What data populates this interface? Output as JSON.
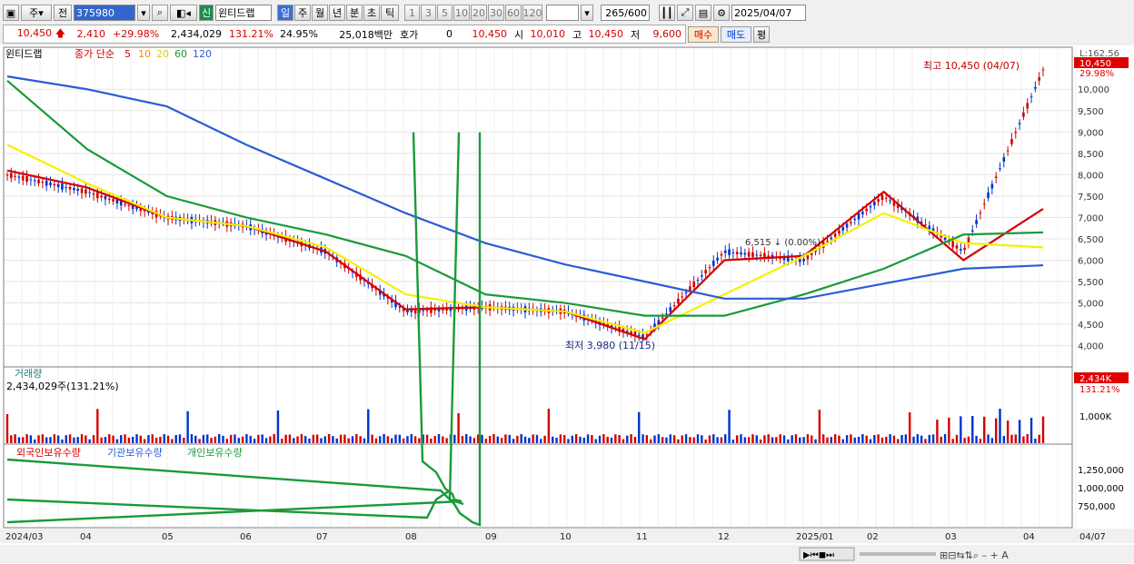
{
  "toolbar": {
    "type": "주",
    "market": "전",
    "code": "375980",
    "badge": "신",
    "name": "윈티드랩",
    "periods": [
      "일",
      "주",
      "월",
      "년",
      "분",
      "초",
      "틱"
    ],
    "intervals": [
      "1",
      "3",
      "5",
      "10",
      "20",
      "30",
      "60",
      "120"
    ],
    "count": "265",
    "total": "/600",
    "date": "2025/04/07"
  },
  "quote": {
    "price": "10,450",
    "change": "2,410",
    "rate": "+29.98%",
    "volume": "2,434,029",
    "vol_rate": "131.21%",
    "turnover": "24.95%",
    "amount": "25,018백만",
    "hoga_label": "호가",
    "hoga": "0",
    "ask": "10,450",
    "open_label": "시",
    "open": "10,010",
    "high_label": "고",
    "high": "10,450",
    "low_label": "저",
    "low": "9,600",
    "buy": "매수",
    "sell": "매도",
    "eval": "평"
  },
  "colors": {
    "up": "#d40000",
    "down": "#0033cc",
    "ma5": "#d40000",
    "ma10": "#ff8c00",
    "ma20": "#f5f000",
    "ma60": "#1a9a3a",
    "ma120": "#2b5cd6"
  },
  "price_panel": {
    "legend_name": "윈티드랩",
    "legend_label": "종가 단순",
    "ma": [
      "5",
      "10",
      "20",
      "60",
      "120"
    ],
    "top_label": "L:162.56",
    "last_price": "10,450",
    "last_rate": "29.98%",
    "y_ticks": [
      "10,000",
      "9,500",
      "9,000",
      "8,500",
      "8,000",
      "7,500",
      "7,000",
      "6,500",
      "6,000",
      "5,500",
      "5,000",
      "4,500",
      "4,000"
    ],
    "high_note": "최고 10,450 (04/07)",
    "low_note": "최저 3,980 (11/15)",
    "mid_note": "6,515 ↓ (0.00%)"
  },
  "volume_panel": {
    "title": "거래량",
    "value": "2,434,029주(131.21%)",
    "badge": "2,434K",
    "badge_rate": "131.21%",
    "tick": "1,000K"
  },
  "holding_panel": {
    "series": [
      "외국인보유수량",
      "기관보유수량",
      "개인보유수량"
    ],
    "ticks": [
      "1,250,000",
      "1,000,000",
      "750,000"
    ]
  },
  "x_axis": [
    "2024/03",
    "04",
    "05",
    "06",
    "07",
    "08",
    "09",
    "10",
    "11",
    "12",
    "2025/01",
    "02",
    "03",
    "04",
    "04/07"
  ],
  "chart_data": {
    "type": "line",
    "title": "윈티드랩",
    "x": [
      "2024/03",
      "04",
      "05",
      "06",
      "07",
      "08",
      "09",
      "10",
      "11",
      "12",
      "2025/01",
      "02",
      "03",
      "04"
    ],
    "series": [
      {
        "name": "종가",
        "values": [
          8000,
          7600,
          7000,
          6800,
          6200,
          4800,
          4900,
          4800,
          4200,
          6200,
          6000,
          7500,
          6200,
          10450
        ]
      },
      {
        "name": "5",
        "values": [
          8100,
          7700,
          7000,
          6800,
          6200,
          4850,
          4900,
          4800,
          4150,
          6000,
          6100,
          7600,
          6000,
          7200
        ]
      },
      {
        "name": "20",
        "values": [
          8700,
          7800,
          7000,
          6800,
          6300,
          5200,
          4900,
          4800,
          4300,
          5200,
          6100,
          7100,
          6400,
          6300
        ]
      },
      {
        "name": "60",
        "values": [
          10200,
          8600,
          7500,
          7000,
          6600,
          6100,
          5200,
          5000,
          4700,
          4700,
          5200,
          5800,
          6600,
          6650
        ]
      },
      {
        "name": "120",
        "values": [
          10300,
          10000,
          9600,
          8700,
          7900,
          7100,
          6400,
          5900,
          5500,
          5100,
          5100,
          5450,
          5800,
          5880
        ]
      }
    ],
    "ylim": [
      3800,
      10600
    ]
  }
}
